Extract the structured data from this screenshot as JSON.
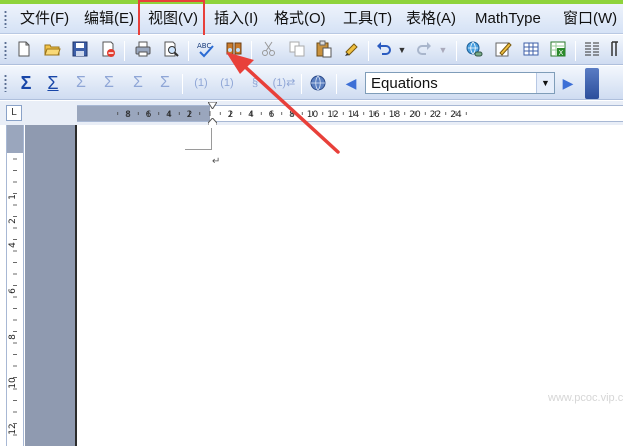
{
  "menubar": {
    "items": [
      {
        "label": "文件(F)"
      },
      {
        "label": "编辑(E)"
      },
      {
        "label": "视图(V)"
      },
      {
        "label": "插入(I)"
      },
      {
        "label": "格式(O)"
      },
      {
        "label": "工具(T)"
      },
      {
        "label": "表格(A)"
      },
      {
        "label": "MathType"
      },
      {
        "label": "窗口(W)"
      }
    ],
    "highlighted_item": "视图(V)"
  },
  "toolbar_standard": {
    "icons": [
      "new-document-icon",
      "open-folder-icon",
      "save-icon",
      "permission-icon",
      "print-icon",
      "print-preview-icon",
      "spelling-check-icon",
      "research-icon",
      "cut-icon",
      "copy-icon",
      "paste-icon",
      "format-painter-icon",
      "undo-icon",
      "redo-icon",
      "hyperlink-icon",
      "drawing-icon",
      "insert-table-icon",
      "insert-excel-icon",
      "columns-icon",
      "show-hide-icon"
    ]
  },
  "toolbar_mathtype": {
    "style_dropdown": {
      "value": "Equations"
    }
  },
  "ruler": {
    "horizontal_labels": [
      "8",
      "6",
      "4",
      "2",
      "2",
      "4",
      "6",
      "8",
      "10",
      "12",
      "14",
      "16",
      "18",
      "20",
      "22",
      "24"
    ],
    "vertical_labels": [
      "1",
      "2",
      "4",
      "6",
      "8",
      "10",
      "12"
    ]
  },
  "document": {
    "paragraph_mark": "↵"
  },
  "colors": {
    "annotation_red": "#e8403a",
    "accent_green": "#8fd33b",
    "toolbar_blue": "#d5e2f6"
  },
  "watermark": {
    "text": "www.pcoc.vip.com"
  }
}
